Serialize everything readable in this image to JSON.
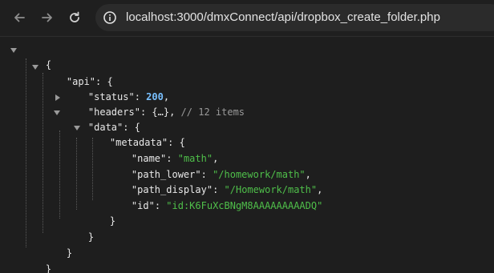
{
  "browser": {
    "url": "localhost:3000/dmxConnect/api/dropbox_create_folder.php",
    "icons": {
      "back": "arrow-left-icon",
      "forward": "arrow-right-icon",
      "reload": "reload-icon",
      "site_info": "info-icon"
    }
  },
  "json_viewer": {
    "open_root": "{",
    "api_key": "\"api\"",
    "colon_space": ": ",
    "open_brace": "{",
    "status_key": "\"status\"",
    "status_value": "200",
    "comma": ",",
    "headers_key": "\"headers\"",
    "headers_collapsed": "{…}",
    "headers_comment": "// 12 items",
    "data_key": "\"data\"",
    "metadata_key": "\"metadata\"",
    "name_key": "\"name\"",
    "name_value": "\"math\"",
    "path_lower_key": "\"path_lower\"",
    "path_lower_value": "\"/homework/math\"",
    "path_display_key": "\"path_display\"",
    "path_display_value": "\"/Homework/math\"",
    "id_key": "\"id\"",
    "id_value": "\"id:K6FuXcBNgM8AAAAAAAAADQ\"",
    "close_brace": "}"
  },
  "colors": {
    "background": "#1e1e1e",
    "string": "#4fbf4a",
    "number": "#79c0ff",
    "comment": "#9a9a9a"
  }
}
